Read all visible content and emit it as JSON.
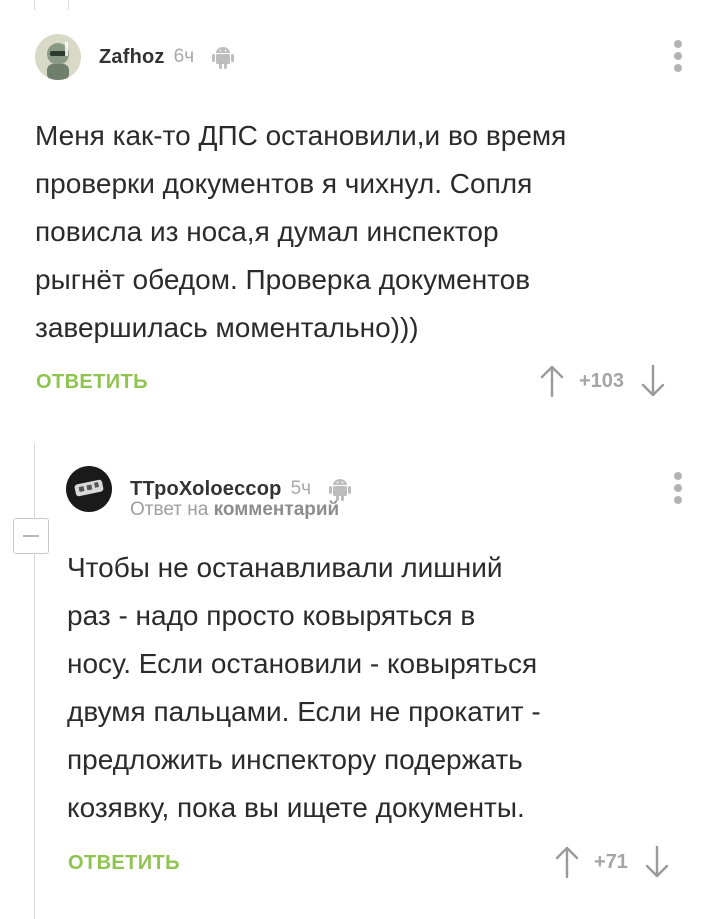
{
  "comments": [
    {
      "username": "Zafhoz",
      "time": "6ч",
      "platform_icon": "android-icon",
      "text": "Меня как-то ДПС остановили,и во время\nпроверки документов я чихнул. Сопля\nповисла из носа,я думал инспектор\nрыгнёт обедом. Проверка документов\nзавершилась моментально)))",
      "reply_label": "ОТВЕТИТЬ",
      "rating": "+103"
    },
    {
      "username": "ТТроХоloeccop",
      "time": "5ч",
      "platform_icon": "android-icon",
      "reply_to_prefix": "Ответ на",
      "reply_to_link": "комментарий",
      "text": "Чтобы не останавливали лишний\nраз - надо просто ковыряться в\nносу. Если остановили - ковыряться\nдвумя пальцами. Если не прокатит -\nпредложить инспектору подержать\nкозявку, пока вы ищете документы.",
      "reply_label": "ОТВЕТИТЬ",
      "rating": "+71"
    }
  ],
  "colors": {
    "accent_green": "#8fc44e",
    "muted_gray": "#a5a5a5",
    "text": "#2b2b2b"
  }
}
